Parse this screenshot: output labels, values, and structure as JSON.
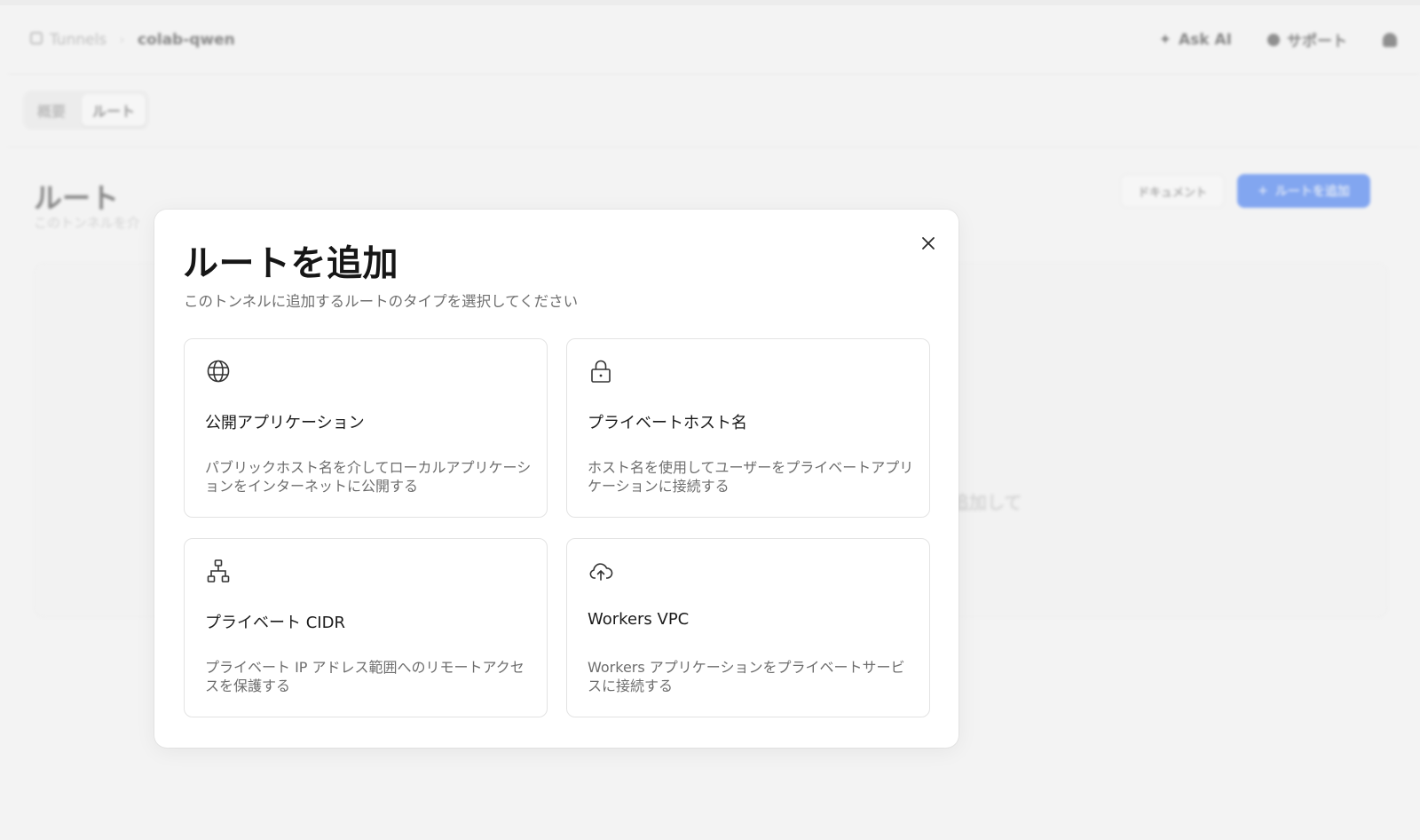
{
  "breadcrumb": {
    "root": "Tunnels",
    "current": "colab-qwen"
  },
  "header": {
    "ask_ai": "Ask AI",
    "support": "サポート"
  },
  "tabs": [
    {
      "label": "概要"
    },
    {
      "label": "ルート"
    }
  ],
  "page": {
    "title": "ルート",
    "subtitle": "このトンネルを介",
    "doc_button": "ドキュメント",
    "add_button": "ルートを追加",
    "empty_hint": "追加して"
  },
  "modal": {
    "title": "ルートを追加",
    "subtitle": "このトンネルに追加するルートのタイプを選択してください",
    "options": [
      {
        "icon": "globe-icon",
        "title": "公開アプリケーション",
        "desc": "パブリックホスト名を介してローカルアプリケーションをインターネットに公開する"
      },
      {
        "icon": "lock-icon",
        "title": "プライベートホスト名",
        "desc": "ホスト名を使用してユーザーをプライベートアプリケーションに接続する"
      },
      {
        "icon": "network-icon",
        "title": "プライベート CIDR",
        "desc": "プライベート IP アドレス範囲へのリモートアクセスを保護する"
      },
      {
        "icon": "cloud-upload-icon",
        "title": "Workers VPC",
        "desc": "Workers アプリケーションをプライベートサービスに接続する"
      }
    ]
  },
  "colors": {
    "accent": "#2d6ef5",
    "modal_bg": "#ffffff",
    "border": "#e3e3e3"
  }
}
